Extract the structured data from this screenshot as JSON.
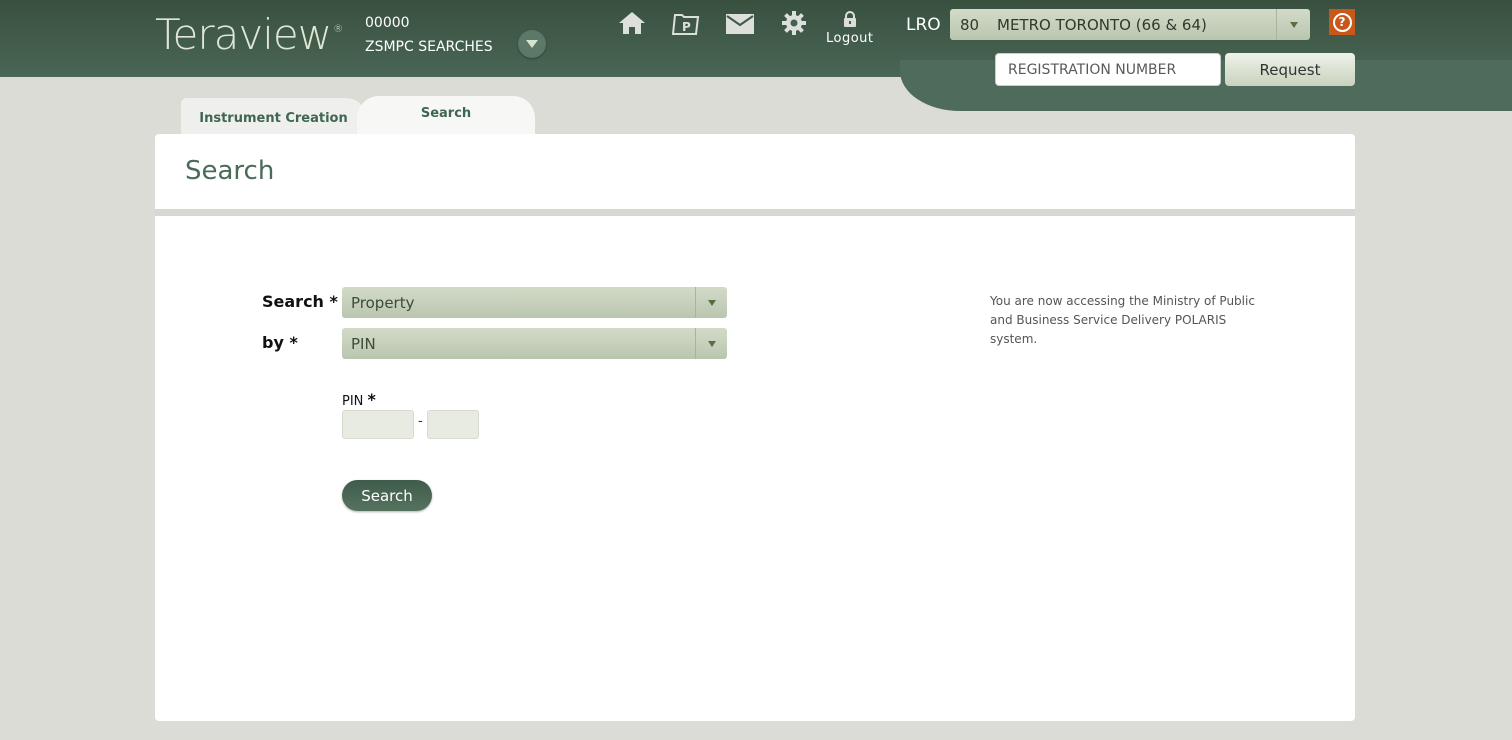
{
  "header": {
    "logo": "Teraview",
    "logo_mark": "®",
    "account_number": "00000",
    "account_name": "ZSMPC SEARCHES",
    "icons": [
      "home-icon",
      "parcel-folder-icon",
      "mail-icon",
      "gear-icon",
      "lock-icon"
    ],
    "logout_label": "Logout",
    "lro_label": "LRO",
    "lro_select": {
      "number": "80",
      "name": "METRO TORONTO (66 & 64)"
    },
    "help_label": "?",
    "registration_placeholder": "REGISTRATION NUMBER",
    "registration_value": "",
    "request_label": "Request"
  },
  "tabs": [
    {
      "label": "Instrument Creation",
      "active": false
    },
    {
      "label": "Search",
      "active": true
    }
  ],
  "page": {
    "title": "Search",
    "search_label": "Search *",
    "search_value": "Property",
    "by_label": "by *",
    "by_value": "PIN",
    "pin_label": "PIN",
    "pin_required": "*",
    "pin_part1": "",
    "pin_part2": "",
    "pin_separator": "-",
    "search_button": "Search",
    "notice": "You are now accessing the Ministry of Public and Business Service Delivery POLARIS system."
  },
  "colors": {
    "header_dark": "#39503f",
    "accent_green": "#4a6b58",
    "help_orange": "#c8571a",
    "select_green": "#c6d0bb"
  }
}
